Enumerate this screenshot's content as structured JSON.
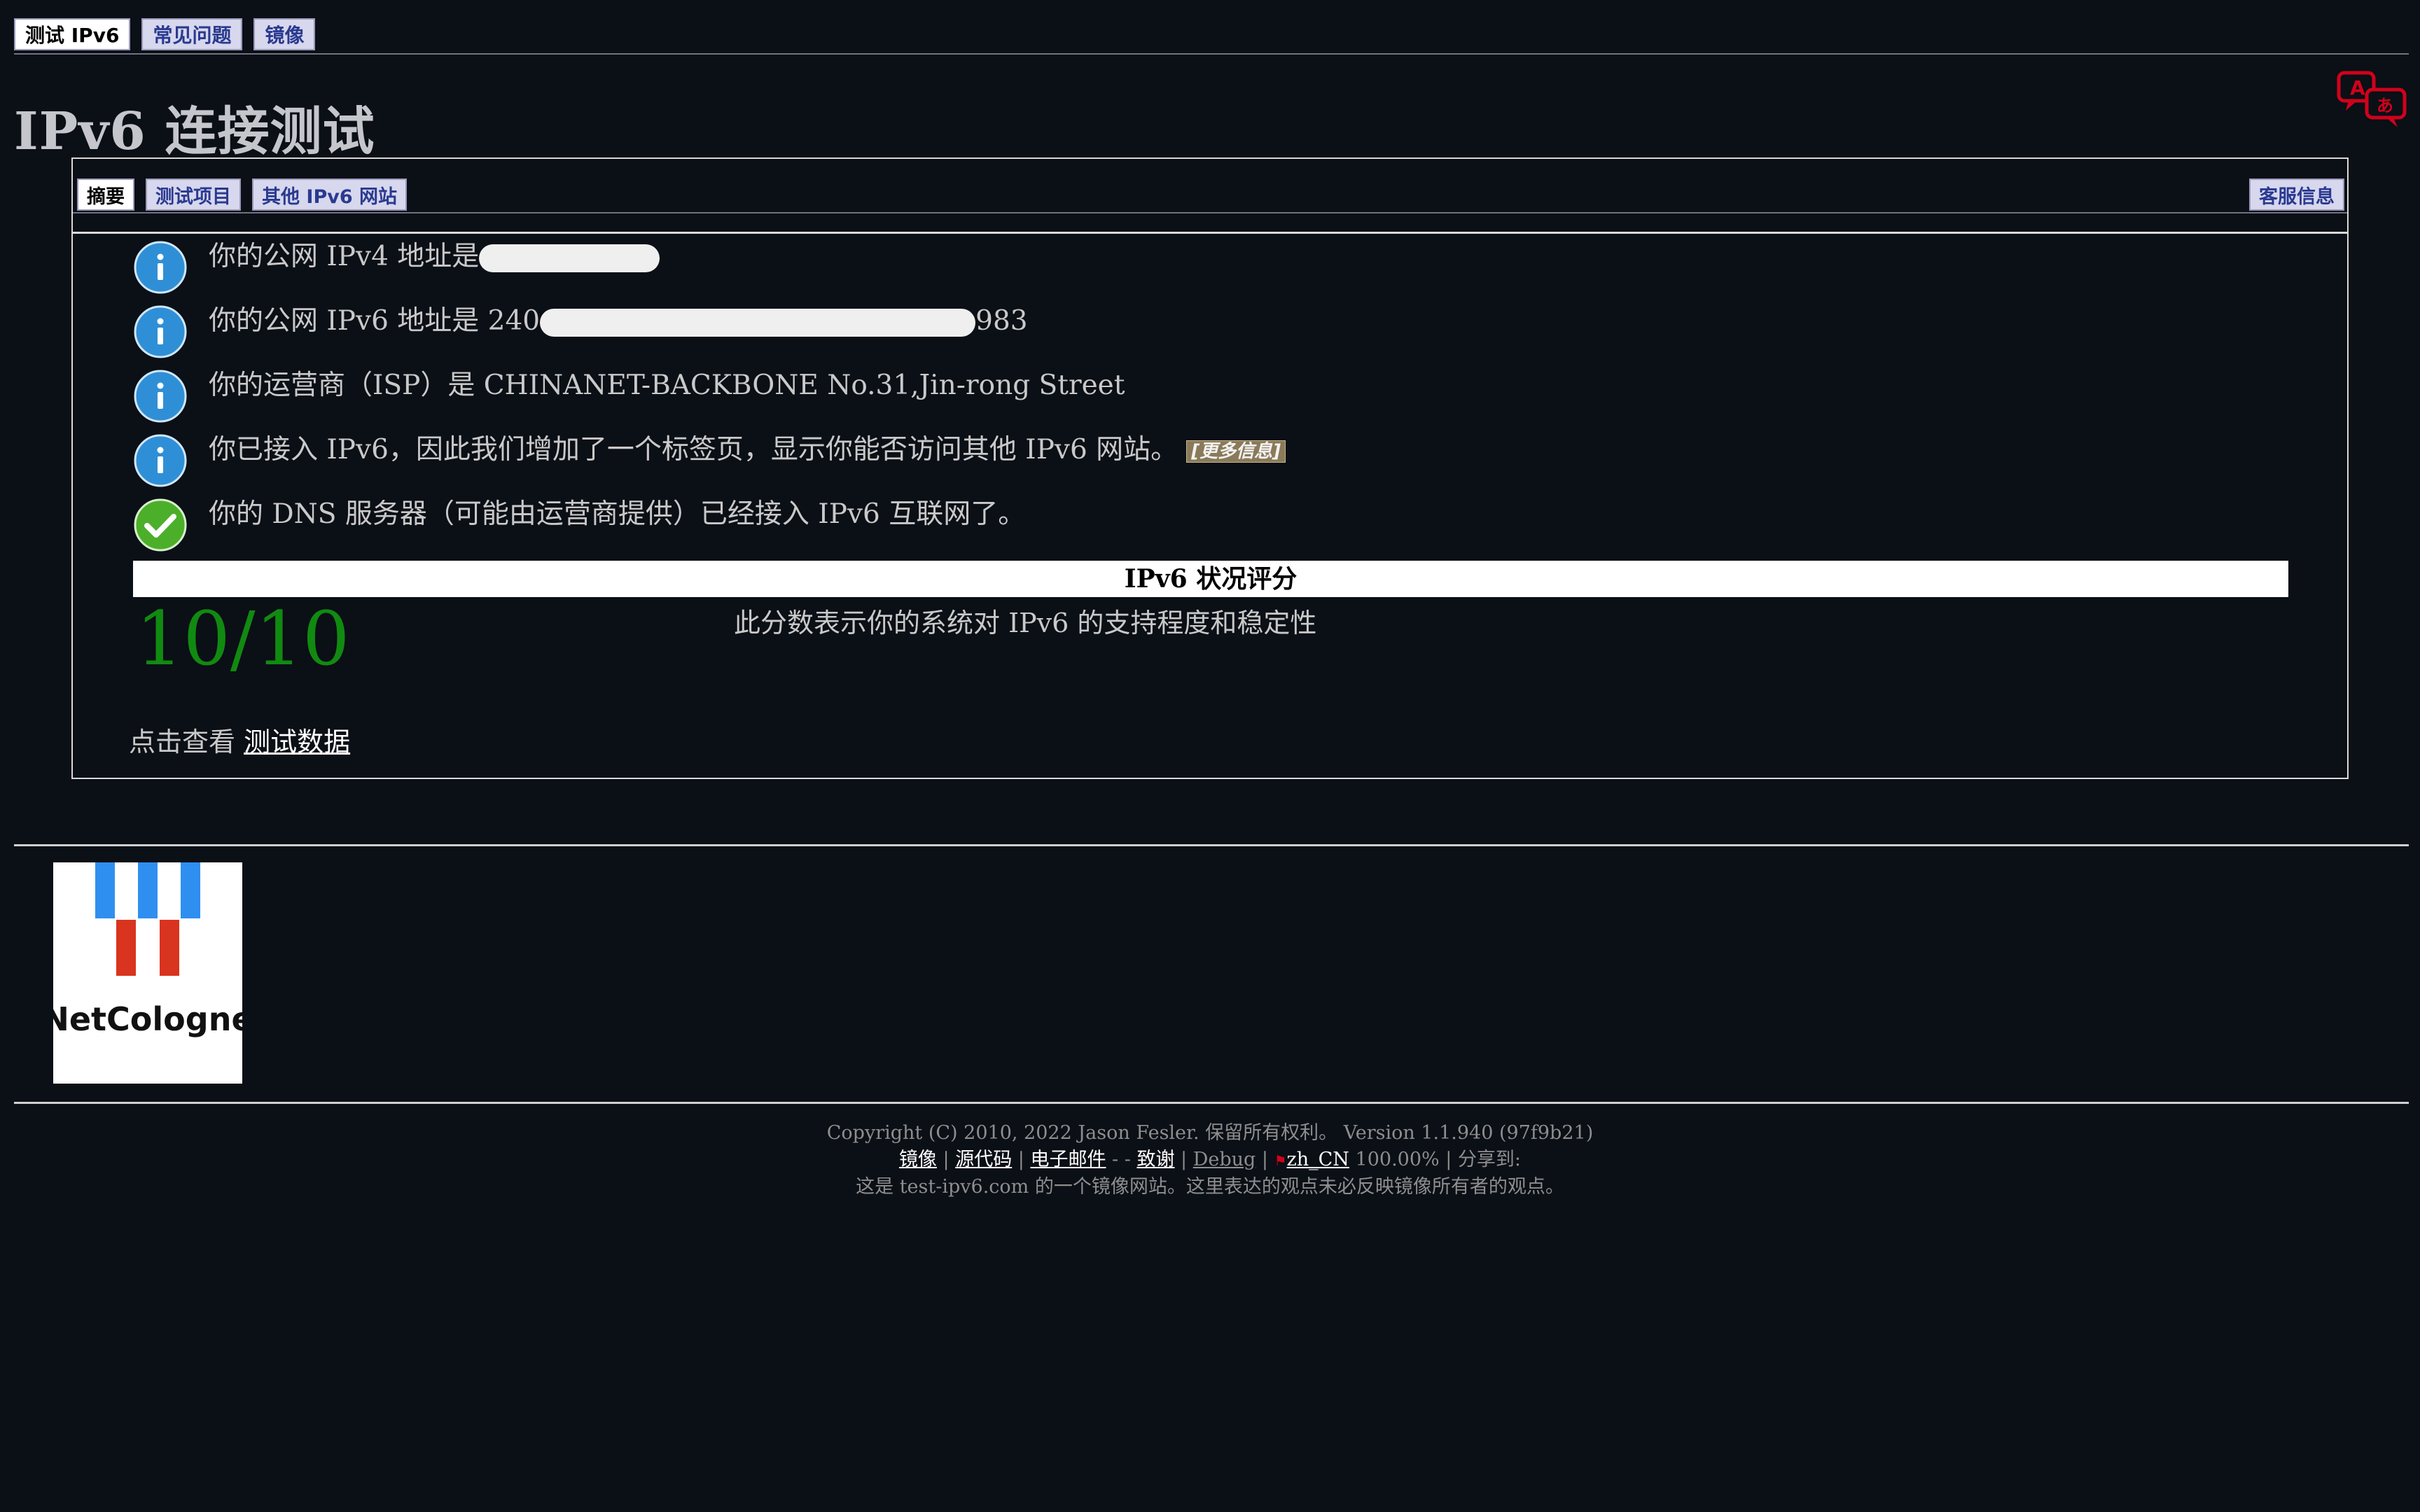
{
  "top_tabs": [
    "测试 IPv6",
    "常见问题",
    "镜像"
  ],
  "page_title": "IPv6 连接测试",
  "inner_tabs": [
    "摘要",
    "测试项目",
    "其他 IPv6 网站"
  ],
  "support_tab": "客服信息",
  "messages": [
    {
      "icon": "info-icon",
      "text": "你的公网 IPv4 地址是"
    },
    {
      "icon": "info-icon",
      "text_before": "你的公网 IPv6 地址是 240",
      "text_after": "983"
    },
    {
      "icon": "info-icon",
      "text": "你的运营商（ISP）是 CHINANET-BACKBONE No.31,Jin-rong Street"
    },
    {
      "icon": "info-icon",
      "text": "你已接入 IPv6，因此我们增加了一个标签页，显示你能否访问其他 IPv6 网站。",
      "more": "[更多信息]"
    },
    {
      "icon": "check-icon",
      "text": "你的 DNS 服务器（可能由运营商提供）已经接入 IPv6 互联网了。"
    }
  ],
  "score": {
    "title": "IPv6 状况评分",
    "value": "10/10",
    "description": "此分数表示你的系统对 IPv6 的支持程度和稳定性"
  },
  "view_data": {
    "prefix": "点击查看",
    "link": "测试数据"
  },
  "mirror_logo_text": "NetCologne",
  "footer": {
    "copyright": "Copyright (C) 2010, 2022 Jason Fesler. 保留所有权利。 Version 1.1.940 (97f9b21)",
    "links": [
      "镜像",
      "源代码",
      "电子邮件"
    ],
    "thanks": "致谢",
    "debug": "Debug",
    "locale": "zh_CN",
    "locale_pct": "100.00%",
    "share": "分享到:",
    "mirror_note": "这是 test-ipv6.com 的一个镜像网站。这里表达的观点未必反映镜像所有者的观点。"
  },
  "colors": {
    "background": "#0b0f16",
    "score_green": "#118a11",
    "info_blue": "#2f8fd6",
    "check_green": "#4caf2a",
    "tab_bg": "#d7d7ee",
    "tab_text": "#2a3a8f"
  }
}
